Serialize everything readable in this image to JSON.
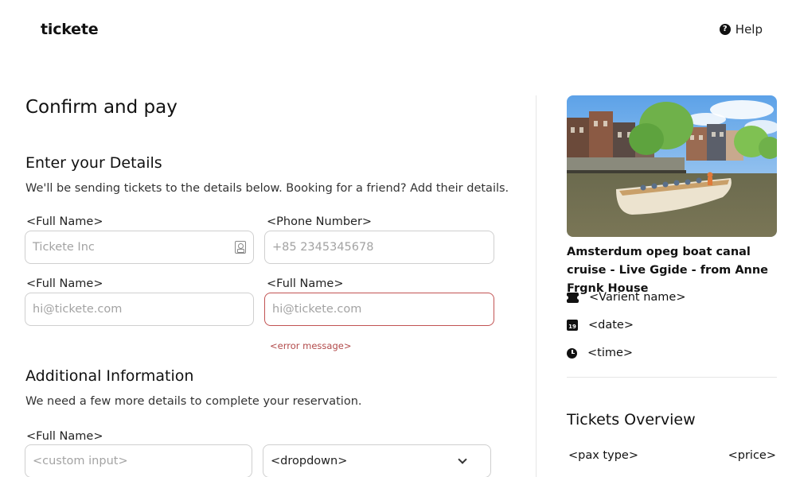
{
  "header": {
    "logo": "tickete",
    "help_label": "Help"
  },
  "page": {
    "title": "Confirm and pay"
  },
  "details": {
    "title": "Enter your Details",
    "description": "We'll be sending tickets to the details below. Booking for a friend? Add their details.",
    "fields": [
      {
        "label": "<Full Name>",
        "placeholder": "Tickete Inc"
      },
      {
        "label": "<Phone Number>",
        "placeholder": "+85 2345345678"
      },
      {
        "label": "<Full Name>",
        "placeholder": "hi@tickete.com"
      },
      {
        "label": "<Full Name>",
        "placeholder": "hi@tickete.com",
        "error": "<error message>"
      }
    ]
  },
  "additional": {
    "title": "Additional Information",
    "description": "We need a few more details to complete your reservation.",
    "field_label": "<Full Name>",
    "custom_placeholder": "<custom input>",
    "dropdown_value": "<dropdown>"
  },
  "summary": {
    "tour_title": "Amsterdum opeg boat canal cruise - Live Ggide - from Anne Frgnk House",
    "variant": "<Varient name>",
    "date": "<date>",
    "date_icon_text": "19",
    "time": "<time>",
    "overview_title": "Tickets Overview",
    "pax_type": "<pax type>",
    "price": "<price>"
  },
  "colors": {
    "error": "#c25353",
    "border": "#cfcfcf"
  }
}
